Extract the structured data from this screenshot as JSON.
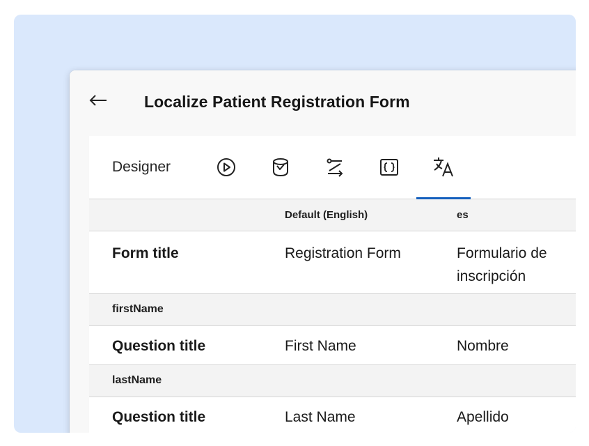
{
  "header": {
    "back_icon": "arrow-left-icon",
    "title": "Localize Patient Registration Form"
  },
  "tabs": [
    {
      "label": "Designer",
      "icon": null,
      "active": false
    },
    {
      "label": "",
      "icon": "play-circle-icon",
      "active": false
    },
    {
      "label": "",
      "icon": "database-icon",
      "active": false
    },
    {
      "label": "",
      "icon": "logic-branch-icon",
      "active": false
    },
    {
      "label": "",
      "icon": "json-braces-icon",
      "active": false
    },
    {
      "label": "",
      "icon": "translate-icon",
      "active": true
    }
  ],
  "accent_color": "#1560bd",
  "table": {
    "columns": [
      "",
      "Default (English)",
      "es"
    ],
    "rows": [
      {
        "type": "item",
        "label": "Form title",
        "default": "Registration Form",
        "es": "Formulario de inscripción"
      },
      {
        "type": "group",
        "label": "firstName"
      },
      {
        "type": "item",
        "label": "Question title",
        "default": "First Name",
        "es": "Nombre"
      },
      {
        "type": "group",
        "label": "lastName"
      },
      {
        "type": "item",
        "label": "Question title",
        "default": "Last Name",
        "es": "Apellido"
      }
    ]
  }
}
